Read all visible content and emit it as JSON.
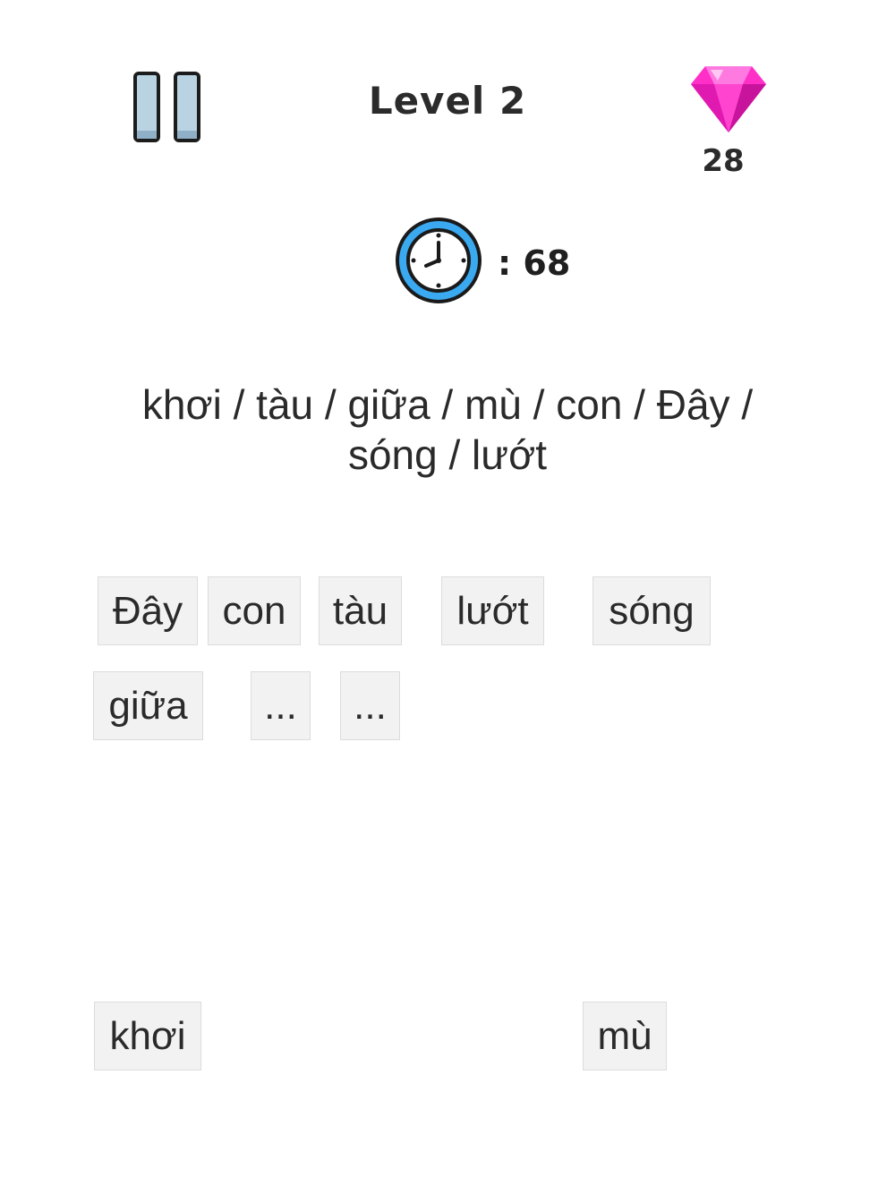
{
  "header": {
    "level_label": "Level 2",
    "gem_count": "28"
  },
  "timer": {
    "text": ": 68"
  },
  "question": {
    "line1": "khơi / tàu / giữa / mù / con / Đây /",
    "line2": "sóng / lướt"
  },
  "answer_slots": [
    "Đây",
    "con",
    "tàu",
    "lướt",
    "sóng",
    "giữa",
    "...",
    "..."
  ],
  "word_bank": [
    "khơi",
    "mù"
  ],
  "colors": {
    "gem": "#ff2fc8",
    "clock_ring": "#3aa9f0",
    "pause_bar": "#b9d3e3",
    "tile_bg": "#f2f2f2"
  },
  "icons": {
    "pause": "pause-icon",
    "gem": "gem-icon",
    "clock": "clock-icon"
  }
}
